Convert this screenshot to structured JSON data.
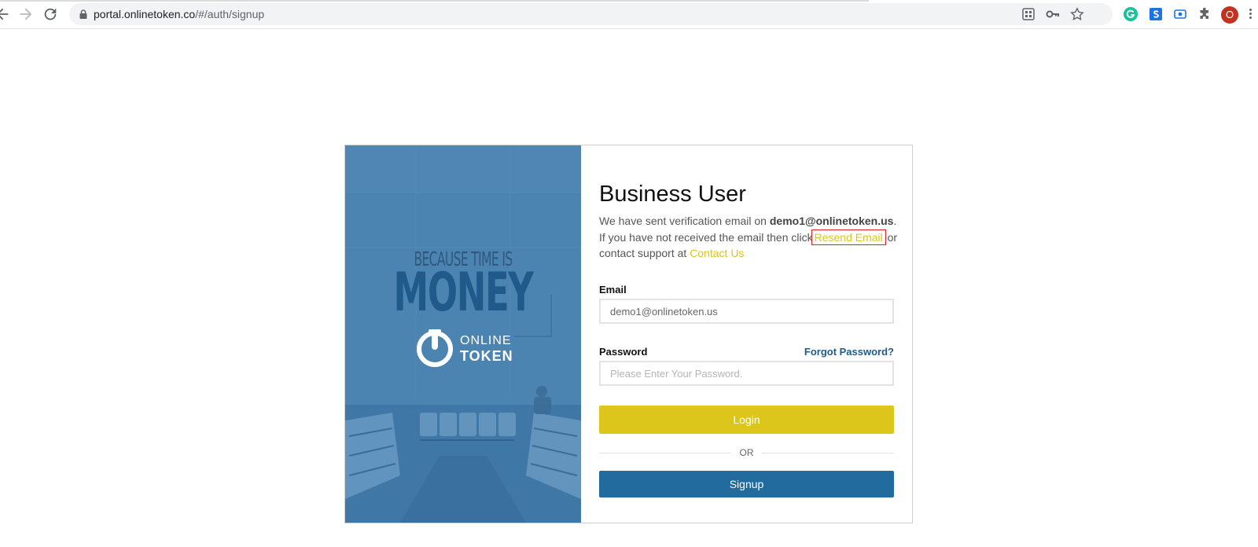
{
  "browser": {
    "url_domain": "portal.onlinetoken.co",
    "url_path": "/#/auth/signup",
    "profile_initial": "O"
  },
  "hero": {
    "tagline_small": "BECAUSE TIME IS",
    "tagline_big": "MONEY",
    "logo_line1": "ONLINE",
    "logo_line2": "TOKEN",
    "background_color": "#4a82b0"
  },
  "form": {
    "title": "Business User",
    "message_prefix": "We have sent verification email on ",
    "message_email": "demo1@onlinetoken.us",
    "message_middle": ". If you have not received the email then click",
    "resend_link": "Resend Email",
    "message_suffix": " or contact support at ",
    "contact_link": "Contact Us",
    "email_label": "Email",
    "email_value": "demo1@onlinetoken.us",
    "password_label": "Password",
    "forgot_link": "Forgot Password?",
    "password_placeholder": "Please Enter Your Password.",
    "login_button": "Login",
    "or_text": "OR",
    "signup_button": "Signup"
  },
  "colors": {
    "accent_yellow": "#ddc61c",
    "link_yellow": "#ddc41c",
    "primary_blue": "#216b9f",
    "highlight_red": "#e02020"
  }
}
